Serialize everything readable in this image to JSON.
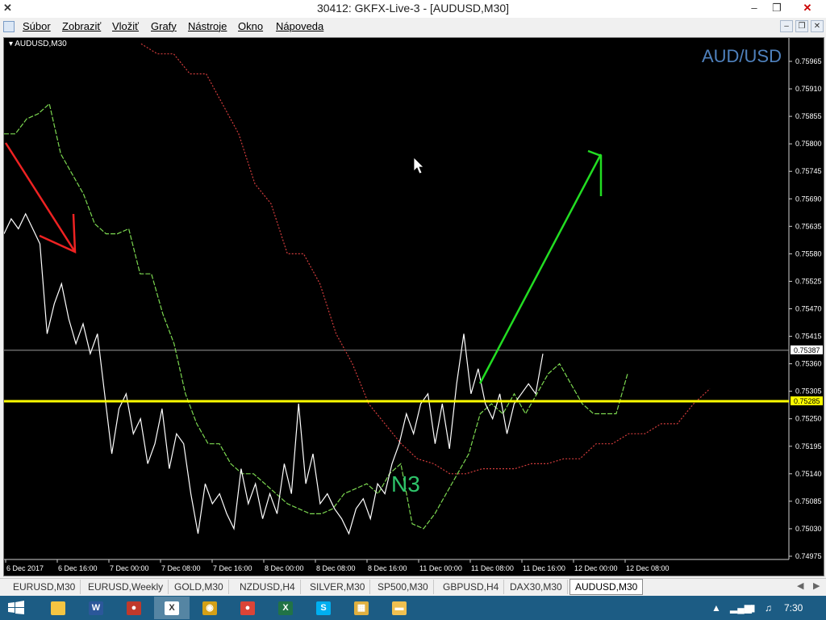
{
  "window": {
    "title": "30412: GKFX-Live-3 - [AUDUSD,M30]",
    "app_icon": "x-logo-icon",
    "controls": [
      "minimize-icon",
      "maximize-icon",
      "close-icon"
    ]
  },
  "menu": {
    "items": [
      "Súbor",
      "Zobraziť",
      "Vložiť",
      "Grafy",
      "Nástroje",
      "Okno",
      "Nápoveda"
    ]
  },
  "chart": {
    "symbol_label": "AUDUSD,M30",
    "watermark": "AUD/USD",
    "annotation": "N3",
    "current_price_label": "0.75387",
    "line_price_label": "0.75285",
    "colors": {
      "background": "#000000",
      "price": "#ffffff",
      "green_line": "#7cd850",
      "red_line": "#d23c3c",
      "hline": "#ffff00",
      "arrow_up": "#22dd22",
      "arrow_down": "#ee2222",
      "annotation": "#2ec46a",
      "watermark": "#4f81bd"
    }
  },
  "chart_data": {
    "type": "line",
    "title": "",
    "y_ticks": [
      "0.75965",
      "0.75910",
      "0.75855",
      "0.75800",
      "0.75745",
      "0.75690",
      "0.75635",
      "0.75580",
      "0.75525",
      "0.75470",
      "0.75415",
      "0.75360",
      "0.75305",
      "0.75250",
      "0.75195",
      "0.75140",
      "0.75085",
      "0.75030",
      "0.74975"
    ],
    "ylim": [
      0.74975,
      0.75965
    ],
    "x_ticks": [
      "6 Dec 2017",
      "6 Dec 16:00",
      "7 Dec 00:00",
      "7 Dec 08:00",
      "7 Dec 16:00",
      "8 Dec 00:00",
      "8 Dec 08:00",
      "8 Dec 16:00",
      "11 Dec 00:00",
      "11 Dec 08:00",
      "11 Dec 16:00",
      "12 Dec 00:00",
      "12 Dec 08:00"
    ],
    "horizontal_line": 0.75285,
    "current_price": 0.75387,
    "series": [
      {
        "values": [
          0.7562,
          0.7565,
          0.7563,
          0.7566,
          0.7563,
          0.756,
          0.7542,
          0.7548,
          0.7552,
          0.7545,
          0.754,
          0.7544,
          0.7538,
          0.7542,
          0.753,
          0.7518,
          0.7527,
          0.753,
          0.7522,
          0.7525,
          0.7516,
          0.752,
          0.7527,
          0.7515,
          0.7522,
          0.752,
          0.751,
          0.7502,
          0.7512,
          0.7508,
          0.751,
          0.7506,
          0.7503,
          0.7515,
          0.7508,
          0.7512,
          0.7505,
          0.751,
          0.7506,
          0.7516,
          0.751,
          0.7528,
          0.7512,
          0.7518,
          0.7508,
          0.751,
          0.7507,
          0.7505,
          0.7502,
          0.7507,
          0.7509,
          0.7505,
          0.7512,
          0.751,
          0.7516,
          0.752,
          0.7526,
          0.7522,
          0.7528,
          0.753,
          0.752,
          0.7528,
          0.7519,
          0.7532,
          0.7542,
          0.753,
          0.7535,
          0.7528,
          0.7525,
          0.753,
          0.7522,
          0.7528,
          0.753,
          0.7532,
          0.753,
          0.7538
        ]
      },
      {
        "values": [
          0.7582,
          0.7582,
          0.7585,
          0.7586,
          0.7588,
          0.7578,
          0.7574,
          0.757,
          0.7564,
          0.7562,
          0.7562,
          0.7563,
          0.7554,
          0.7554,
          0.7546,
          0.754,
          0.753,
          0.7524,
          0.752,
          0.752,
          0.7516,
          0.7514,
          0.7514,
          0.7512,
          0.751,
          0.7508,
          0.7507,
          0.7506,
          0.7506,
          0.7507,
          0.751,
          0.7511,
          0.7512,
          0.751,
          0.7514,
          0.7516,
          0.7504,
          0.7503,
          0.7506,
          0.751,
          0.7514,
          0.7518,
          0.7526,
          0.7528,
          0.7526,
          0.753,
          0.7526,
          0.753,
          0.7534,
          0.7536,
          0.7532,
          0.7528,
          0.7526,
          0.7526,
          0.7526,
          0.7534
        ]
      },
      {
        "values": [
          0.76,
          0.7598,
          0.7598,
          0.7594,
          0.7594,
          0.7588,
          0.7582,
          0.7572,
          0.7568,
          0.7558,
          0.7558,
          0.7552,
          0.7542,
          0.7536,
          0.7528,
          0.7524,
          0.752,
          0.7517,
          0.7516,
          0.7514,
          0.7514,
          0.7515,
          0.7515,
          0.7515,
          0.7516,
          0.7516,
          0.7517,
          0.7517,
          0.752,
          0.752,
          0.7522,
          0.7522,
          0.7524,
          0.7524,
          0.7528,
          0.7531
        ]
      }
    ]
  },
  "tabs": {
    "items": [
      "EURUSD,M30",
      "EURUSD,Weekly",
      "GOLD,M30",
      "NZDUSD,H4",
      "SILVER,M30",
      "SP500,M30",
      "GBPUSD,H4",
      "DAX30,M30",
      "AUDUSD,M30"
    ],
    "active": "AUDUSD,M30"
  },
  "taskbar": {
    "items": [
      {
        "icon": "file-explorer-icon",
        "color": "#f5c542",
        "glyph": ""
      },
      {
        "icon": "word-icon",
        "color": "#2b579a",
        "glyph": "W"
      },
      {
        "icon": "paint-icon",
        "color": "#c0392b",
        "glyph": "●"
      },
      {
        "icon": "metatrader-icon",
        "color": "#ffffff",
        "glyph": "X"
      },
      {
        "icon": "globe-icon",
        "color": "#d4a017",
        "glyph": "◉"
      },
      {
        "icon": "chrome-icon",
        "color": "#db4437",
        "glyph": "●"
      },
      {
        "icon": "excel-icon",
        "color": "#217346",
        "glyph": "X"
      },
      {
        "icon": "skype-icon",
        "color": "#00aff0",
        "glyph": "S"
      },
      {
        "icon": "photos-icon",
        "color": "#e0b040",
        "glyph": "▦"
      },
      {
        "icon": "folder-icon",
        "color": "#f0c050",
        "glyph": "▬"
      }
    ],
    "clock": "7:30"
  }
}
